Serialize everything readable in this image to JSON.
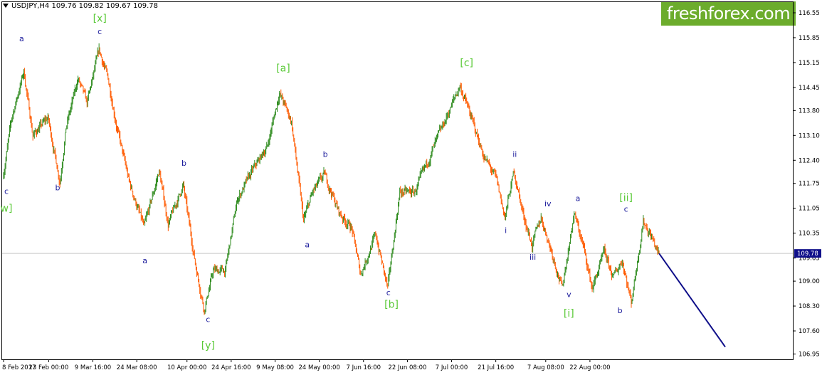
{
  "header": {
    "symbol_line": "USDJPY,H4  109.76 109.82 109.67 109.78",
    "logo_text": "freshforex.com"
  },
  "colors": {
    "bull": "#2e8b1e",
    "bear": "#ff5a00",
    "wave_primary": "#59c936",
    "wave_minor": "#1c1c9c",
    "forecast": "#10108a",
    "price_box": "#10108a",
    "logo_bg": "#6cac2c"
  },
  "chart_data": {
    "type": "candlestick",
    "symbol": "USDJPY",
    "timeframe": "H4",
    "ylim": [
      106.8,
      116.85
    ],
    "y_ticks": [
      116.55,
      115.85,
      115.15,
      114.45,
      113.8,
      113.1,
      112.4,
      111.75,
      111.05,
      110.35,
      109.65,
      109.0,
      108.3,
      107.6,
      106.95
    ],
    "current_price": 109.78,
    "x_ticks": [
      {
        "label": "8 Feb 2017",
        "t": 0
      },
      {
        "label": "23 Feb 00:00",
        "t": 15.0
      },
      {
        "label": "9 Mar 16:00",
        "t": 29.7
      },
      {
        "label": "24 Mar 08:00",
        "t": 44.3
      },
      {
        "label": "10 Apr 00:00",
        "t": 61.0
      },
      {
        "label": "24 Apr 16:00",
        "t": 75.7
      },
      {
        "label": "9 May 08:00",
        "t": 90.3
      },
      {
        "label": "24 May 00:00",
        "t": 105.0
      },
      {
        "label": "7 Jun 16:00",
        "t": 119.7
      },
      {
        "label": "22 Jun 08:00",
        "t": 134.3
      },
      {
        "label": "7 Jul 00:00",
        "t": 149.0
      },
      {
        "label": "21 Jul 16:00",
        "t": 163.7
      },
      {
        "label": "7 Aug 08:00",
        "t": 180.3
      },
      {
        "label": "22 Aug 00:00",
        "t": 195.0
      }
    ],
    "x_range": [
      0,
      262
    ],
    "price_path": [
      {
        "t": 0,
        "p": 111.9
      },
      {
        "t": 3,
        "p": 113.6
      },
      {
        "t": 7,
        "p": 114.9
      },
      {
        "t": 10,
        "p": 113.1
      },
      {
        "t": 15,
        "p": 113.6
      },
      {
        "t": 19,
        "p": 111.8
      },
      {
        "t": 21,
        "p": 113.3
      },
      {
        "t": 25,
        "p": 114.7
      },
      {
        "t": 28,
        "p": 114.0
      },
      {
        "t": 32,
        "p": 115.5
      },
      {
        "t": 35,
        "p": 114.7
      },
      {
        "t": 38,
        "p": 113.3
      },
      {
        "t": 42,
        "p": 111.8
      },
      {
        "t": 47,
        "p": 110.5
      },
      {
        "t": 52,
        "p": 112.1
      },
      {
        "t": 55,
        "p": 110.6
      },
      {
        "t": 60,
        "p": 111.7
      },
      {
        "t": 64,
        "p": 109.5
      },
      {
        "t": 67,
        "p": 108.2
      },
      {
        "t": 70,
        "p": 109.3
      },
      {
        "t": 74,
        "p": 109.3
      },
      {
        "t": 78,
        "p": 111.3
      },
      {
        "t": 83,
        "p": 112.1
      },
      {
        "t": 88,
        "p": 112.8
      },
      {
        "t": 92,
        "p": 114.3
      },
      {
        "t": 96,
        "p": 113.5
      },
      {
        "t": 100,
        "p": 110.7
      },
      {
        "t": 103,
        "p": 111.5
      },
      {
        "t": 107,
        "p": 112.0
      },
      {
        "t": 112,
        "p": 110.9
      },
      {
        "t": 116,
        "p": 110.5
      },
      {
        "t": 119,
        "p": 109.2
      },
      {
        "t": 124,
        "p": 110.3
      },
      {
        "t": 128,
        "p": 108.8
      },
      {
        "t": 132,
        "p": 111.5
      },
      {
        "t": 137,
        "p": 111.5
      },
      {
        "t": 142,
        "p": 112.5
      },
      {
        "t": 147,
        "p": 113.5
      },
      {
        "t": 152,
        "p": 114.5
      },
      {
        "t": 155,
        "p": 113.8
      },
      {
        "t": 160,
        "p": 112.5
      },
      {
        "t": 164,
        "p": 111.9
      },
      {
        "t": 167,
        "p": 110.8
      },
      {
        "t": 170,
        "p": 112.1
      },
      {
        "t": 173,
        "p": 110.9
      },
      {
        "t": 176,
        "p": 110.0
      },
      {
        "t": 179,
        "p": 110.8
      },
      {
        "t": 183,
        "p": 109.7
      },
      {
        "t": 186,
        "p": 108.8
      },
      {
        "t": 190,
        "p": 110.9
      },
      {
        "t": 193,
        "p": 110.0
      },
      {
        "t": 196,
        "p": 108.8
      },
      {
        "t": 200,
        "p": 109.8
      },
      {
        "t": 203,
        "p": 109.1
      },
      {
        "t": 206,
        "p": 109.6
      },
      {
        "t": 209,
        "p": 108.4
      },
      {
        "t": 213,
        "p": 110.7
      },
      {
        "t": 216,
        "p": 110.2
      },
      {
        "t": 218,
        "p": 109.78
      }
    ],
    "forecast_line": [
      {
        "t": 218,
        "p": 109.78
      },
      {
        "t": 240,
        "p": 107.15
      }
    ],
    "wave_labels": [
      {
        "text": "a",
        "t": 6,
        "p": 115.75,
        "style": "minor"
      },
      {
        "text": "c",
        "t": -1,
        "p": 111.45,
        "style": "minor"
      },
      {
        "text": "w]",
        "t": -1,
        "p": 110.95,
        "style": "primary"
      },
      {
        "text": "b",
        "t": 18,
        "p": 111.55,
        "style": "minor"
      },
      {
        "text": "[x]",
        "t": 32,
        "p": 116.3,
        "style": "primary"
      },
      {
        "text": "c",
        "t": 32,
        "p": 115.95,
        "style": "minor"
      },
      {
        "text": "a",
        "t": 47,
        "p": 109.5,
        "style": "minor"
      },
      {
        "text": "b",
        "t": 60,
        "p": 112.25,
        "style": "minor"
      },
      {
        "text": "c",
        "t": 68,
        "p": 107.85,
        "style": "minor"
      },
      {
        "text": "[y]",
        "t": 68,
        "p": 107.1,
        "style": "primary"
      },
      {
        "text": "[a]",
        "t": 93,
        "p": 114.9,
        "style": "primary"
      },
      {
        "text": "a",
        "t": 101,
        "p": 109.95,
        "style": "minor"
      },
      {
        "text": "b",
        "t": 107,
        "p": 112.5,
        "style": "minor"
      },
      {
        "text": "c",
        "t": 128,
        "p": 108.6,
        "style": "minor"
      },
      {
        "text": "[b]",
        "t": 129,
        "p": 108.25,
        "style": "primary"
      },
      {
        "text": "[c]",
        "t": 154,
        "p": 115.05,
        "style": "primary"
      },
      {
        "text": "ii",
        "t": 170,
        "p": 112.5,
        "style": "minor"
      },
      {
        "text": "i",
        "t": 167,
        "p": 110.35,
        "style": "minor"
      },
      {
        "text": "iii",
        "t": 176,
        "p": 109.6,
        "style": "minor"
      },
      {
        "text": "iv",
        "t": 181,
        "p": 111.1,
        "style": "minor"
      },
      {
        "text": "a",
        "t": 191,
        "p": 111.25,
        "style": "minor"
      },
      {
        "text": "v",
        "t": 188,
        "p": 108.55,
        "style": "minor"
      },
      {
        "text": "[i]",
        "t": 188,
        "p": 108.0,
        "style": "primary"
      },
      {
        "text": "[ii]",
        "t": 207,
        "p": 111.25,
        "style": "primary"
      },
      {
        "text": "c",
        "t": 207,
        "p": 110.95,
        "style": "minor"
      },
      {
        "text": "b",
        "t": 205,
        "p": 108.1,
        "style": "minor"
      }
    ]
  }
}
